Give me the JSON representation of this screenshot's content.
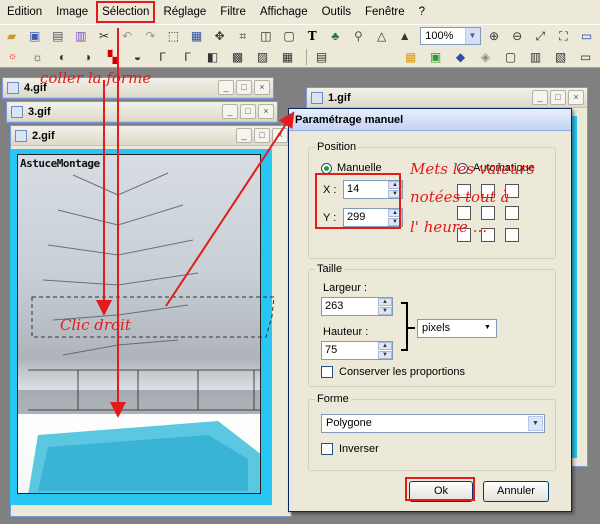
{
  "menu": [
    "Edition",
    "Image",
    "Sélection",
    "Réglage",
    "Filtre",
    "Affichage",
    "Outils",
    "Fenêtre",
    "?"
  ],
  "toolbar": {
    "zoom_value": "100%",
    "row1_icons": [
      "save-icon",
      "print-icon",
      "print-preview-icon",
      "cut-icon",
      "undo-icon",
      "redo-icon",
      "select-icon",
      "copy-icon",
      "move-icon",
      "crop-icon",
      "rectangle-select-icon",
      "frame-icon",
      "text-icon",
      "tree-icon",
      "wand-icon",
      "paint-icon",
      "brush-icon",
      "fill-icon"
    ],
    "row2_icons": [
      "auto-icon",
      "adjust-icon",
      "effect-icon",
      "color-icon",
      "levels-icon",
      "brightness-icon",
      "tone-icon",
      "balance-icon",
      "hue-icon",
      "layer-icon",
      "filter-icon",
      "grid-icon",
      "rotate-icon"
    ],
    "right_icons": [
      "zoom-in-icon",
      "zoom-out-icon",
      "fit-icon",
      "fullscreen-icon",
      "monitor-icon"
    ],
    "row2_right_icons": [
      "palette-icon",
      "swatch-icon",
      "droplet-icon",
      "gradient-icon",
      "frame-icon",
      "fill-icon",
      "text-effect-icon",
      "shape-icon"
    ]
  },
  "windows": {
    "w4_title": "4.gif",
    "w3_title": "3.gif",
    "w2_title": "2.gif",
    "w1_title": "1.gif",
    "image_overlay_text": "AstuceMontage"
  },
  "dialog": {
    "title": "Paramétrage manuel",
    "position_group": "Position",
    "radio_manual": "Manuelle",
    "radio_auto": "Automatique",
    "x_label": "X :",
    "x_value": "14",
    "y_label": "Y :",
    "y_value": "299",
    "size_group": "Taille",
    "width_label": "Largeur :",
    "width_value": "263",
    "height_label": "Hauteur :",
    "height_value": "75",
    "unit_value": "pixels",
    "keep_proportions": "Conserver les proportions",
    "shape_group": "Forme",
    "shape_value": "Polygone",
    "invert_label": "Inverser",
    "ok_label": "Ok",
    "cancel_label": "Annuler"
  },
  "annotations": {
    "paste_shape": "coller la forme",
    "right_click": "Clic droit",
    "instruction_line1": "Mets les valeurs",
    "instruction_line2": "notées tout à",
    "instruction_line3": "l' heure ..."
  },
  "colors": {
    "annotation_red": "#e31b1b",
    "frame_cyan": "#28c6f4",
    "radio_green": "#21a121"
  }
}
